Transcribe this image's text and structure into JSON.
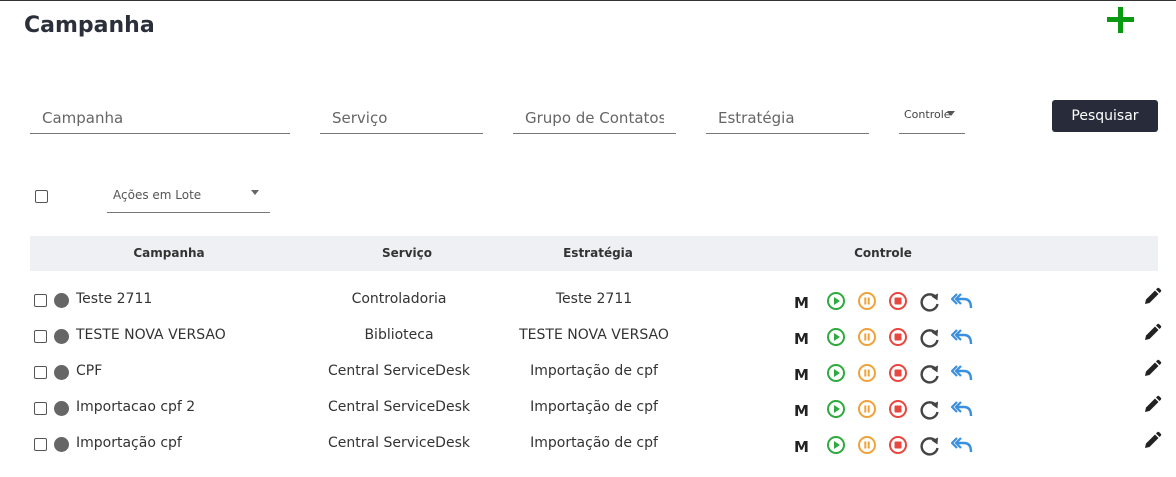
{
  "page": {
    "title": "Campanha"
  },
  "filters": {
    "campanha_placeholder": "Campanha",
    "servico_placeholder": "Serviço",
    "grupo_placeholder": "Grupo de Contatos",
    "estrategia_placeholder": "Estratégia",
    "controle_label": "Controle",
    "search_label": "Pesquisar"
  },
  "bulk": {
    "label": "Ações em Lote"
  },
  "table": {
    "headers": {
      "campanha": "Campanha",
      "servico": "Serviço",
      "estrategia": "Estratégia",
      "controle": "Controle"
    },
    "control_mode_label": "M",
    "rows": [
      {
        "campanha": "Teste 2711",
        "servico": "Controladoria",
        "estrategia": "Teste 2711"
      },
      {
        "campanha": "TESTE NOVA VERSAO",
        "servico": "Biblioteca",
        "estrategia": "TESTE NOVA VERSAO"
      },
      {
        "campanha": "CPF",
        "servico": "Central ServiceDesk",
        "estrategia": "Importação de cpf"
      },
      {
        "campanha": "Importacao cpf 2",
        "servico": "Central ServiceDesk",
        "estrategia": "Importação de cpf"
      },
      {
        "campanha": "Importação cpf",
        "servico": "Central ServiceDesk",
        "estrategia": "Importação de cpf"
      }
    ]
  },
  "icons": {
    "add": "plus-icon",
    "play": "play-circle-icon",
    "pause": "pause-circle-icon",
    "stop": "stop-circle-icon",
    "reload": "reload-icon",
    "reply": "reply-all-icon",
    "edit": "pencil-icon"
  },
  "colors": {
    "add": "#0a9a12",
    "play": "#2eab3e",
    "pause": "#f0a23a",
    "stop": "#e8473f",
    "reload": "#444444",
    "reply": "#3a8fe0",
    "button": "#282c3a",
    "header_bg": "#eef0f4"
  }
}
